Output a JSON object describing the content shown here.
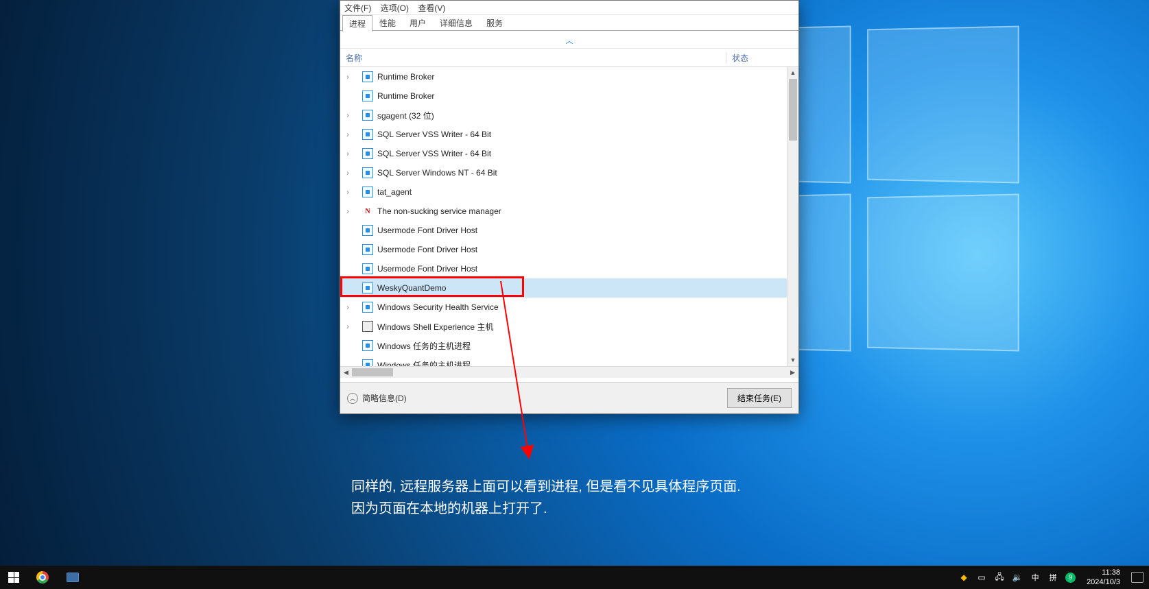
{
  "taskmgr": {
    "menu": {
      "file": "文件(F)",
      "options": "选项(O)",
      "view": "查看(V)"
    },
    "tabs": [
      "进程",
      "性能",
      "用户",
      "详细信息",
      "服务"
    ],
    "active_tab": 0,
    "columns": {
      "name": "名称",
      "state": "状态"
    },
    "collapse_glyph": "︿",
    "processes": [
      {
        "name": "Runtime Broker",
        "expandable": true,
        "icon": "app"
      },
      {
        "name": "Runtime Broker",
        "expandable": false,
        "icon": "app"
      },
      {
        "name": "sgagent (32 位)",
        "expandable": true,
        "icon": "app"
      },
      {
        "name": "SQL Server VSS Writer - 64 Bit",
        "expandable": true,
        "icon": "app"
      },
      {
        "name": "SQL Server VSS Writer - 64 Bit",
        "expandable": true,
        "icon": "app"
      },
      {
        "name": "SQL Server Windows NT - 64 Bit",
        "expandable": true,
        "icon": "app"
      },
      {
        "name": "tat_agent",
        "expandable": true,
        "icon": "app"
      },
      {
        "name": "The non-sucking service manager",
        "expandable": true,
        "icon": "n"
      },
      {
        "name": "Usermode Font Driver Host",
        "expandable": false,
        "icon": "app"
      },
      {
        "name": "Usermode Font Driver Host",
        "expandable": false,
        "icon": "app"
      },
      {
        "name": "Usermode Font Driver Host",
        "expandable": false,
        "icon": "app"
      },
      {
        "name": "WeskyQuantDemo",
        "expandable": false,
        "icon": "app",
        "selected": true,
        "highlighted": true
      },
      {
        "name": "Windows Security Health Service",
        "expandable": true,
        "icon": "app"
      },
      {
        "name": "Windows Shell Experience 主机",
        "expandable": true,
        "icon": "shell"
      },
      {
        "name": "Windows 任务的主机进程",
        "expandable": false,
        "icon": "app"
      },
      {
        "name": "Windows 任务的主机进程",
        "expandable": false,
        "icon": "app"
      }
    ],
    "fewer_details": "简略信息(D)",
    "end_task": "结束任务(E)"
  },
  "annotation": {
    "line1": "同样的, 远程服务器上面可以看到进程, 但是看不见具体程序页面.",
    "line2": "因为页面在本地的机器上打开了."
  },
  "taskbar": {
    "ime_lang": "中",
    "ime_mode": "拼",
    "badge": "9",
    "time": "11:38",
    "date": "2024/10/3"
  }
}
